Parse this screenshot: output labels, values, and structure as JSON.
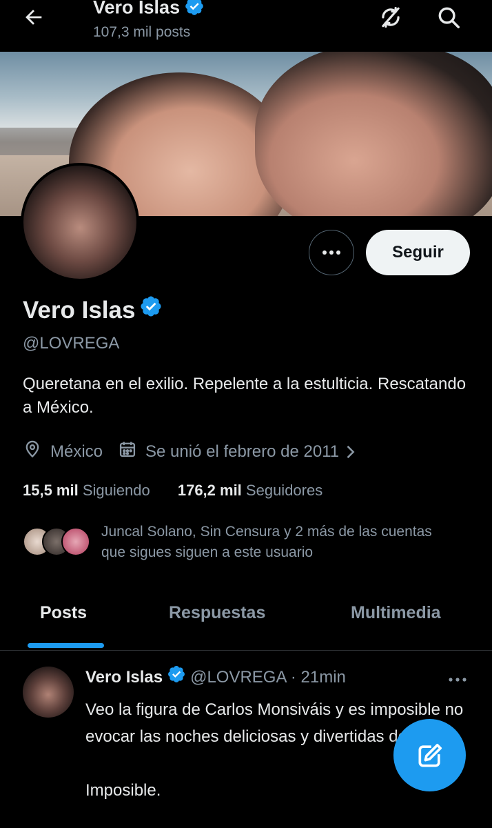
{
  "header": {
    "title": "Vero Islas",
    "posts_count": "107,3 mil posts"
  },
  "profile": {
    "name": "Vero Islas",
    "handle": "@LOVREGA",
    "bio": "Queretana en el exilio. Repelente a la estulticia. Rescatando a México.",
    "location": "México",
    "joined": "Se unió el febrero de 2011",
    "following_count": "15,5 mil",
    "following_label": "Siguiendo",
    "followers_count": "176,2 mil",
    "followers_label": "Seguidores",
    "known_followers": "Juncal Solano, Sin Censura y 2 más de las cuentas que sigues siguen a este usuario",
    "follow_label": "Seguir",
    "verified_color": "#1d9bf0"
  },
  "tabs": [
    {
      "label": "Posts",
      "active": true
    },
    {
      "label": "Respuestas",
      "active": false
    },
    {
      "label": "Multimedia",
      "active": false
    }
  ],
  "tweet": {
    "name": "Vero Islas",
    "handle": "@LOVREGA",
    "separator": "·",
    "time": "21min",
    "text": "Veo la figura de Carlos Monsiváis y es imposible no evocar las noches deliciosas y divertidas de AMLO.\n\nImposible."
  },
  "colors": {
    "background": "#000000",
    "accent": "#1d9bf0",
    "secondary_text": "#8b98a5"
  }
}
